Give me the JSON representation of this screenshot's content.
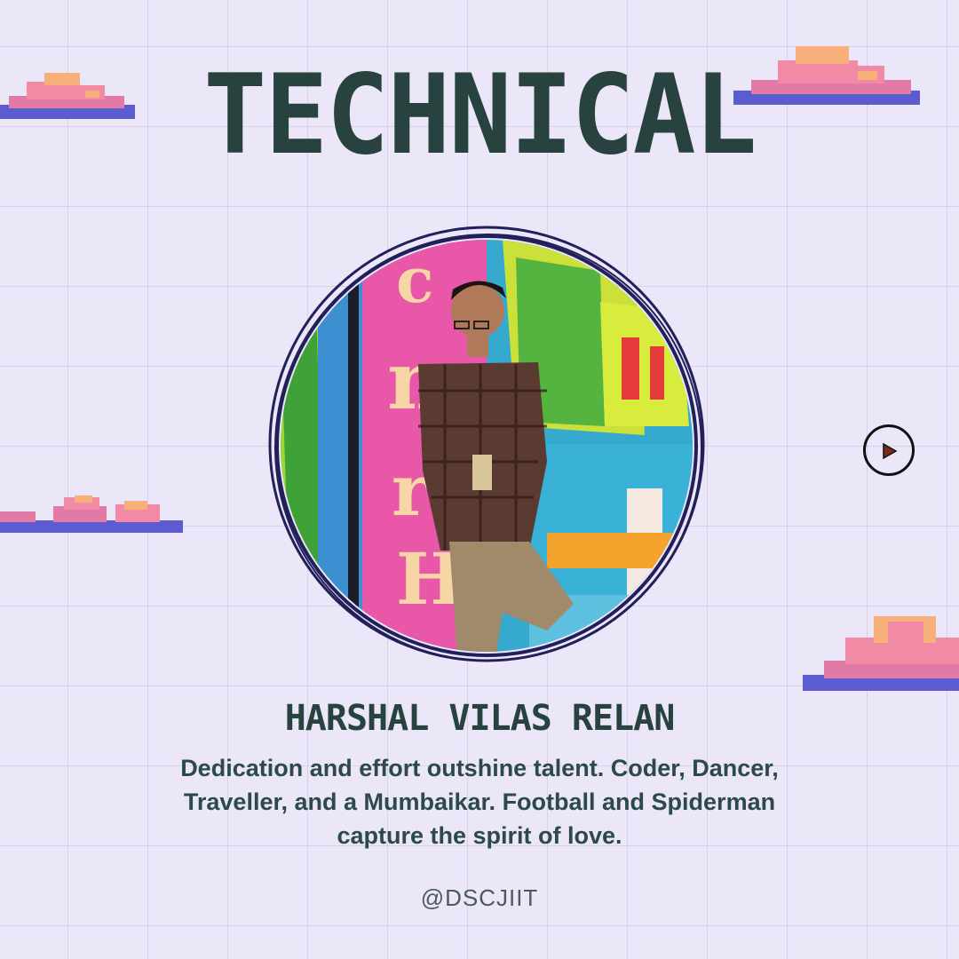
{
  "header": {
    "title": "TECHNICAL"
  },
  "profile": {
    "name": "HARSHAL VILAS RELAN",
    "bio": "Dedication and effort outshine talent. Coder, Dancer, Traveller, and a Mumbaikar.  Football and Spiderman capture the spirit of love.",
    "handle": "@DSCJIIT"
  },
  "icons": {
    "play": "play-icon",
    "cloud": "pixel-cloud-icon"
  },
  "colors": {
    "background": "#ebe6f8",
    "text": "#27423f",
    "cloud_pink": "#f08aa5",
    "cloud_orange": "#f7b07a",
    "cloud_blue": "#5c5bcf",
    "ring": "#22205a"
  }
}
